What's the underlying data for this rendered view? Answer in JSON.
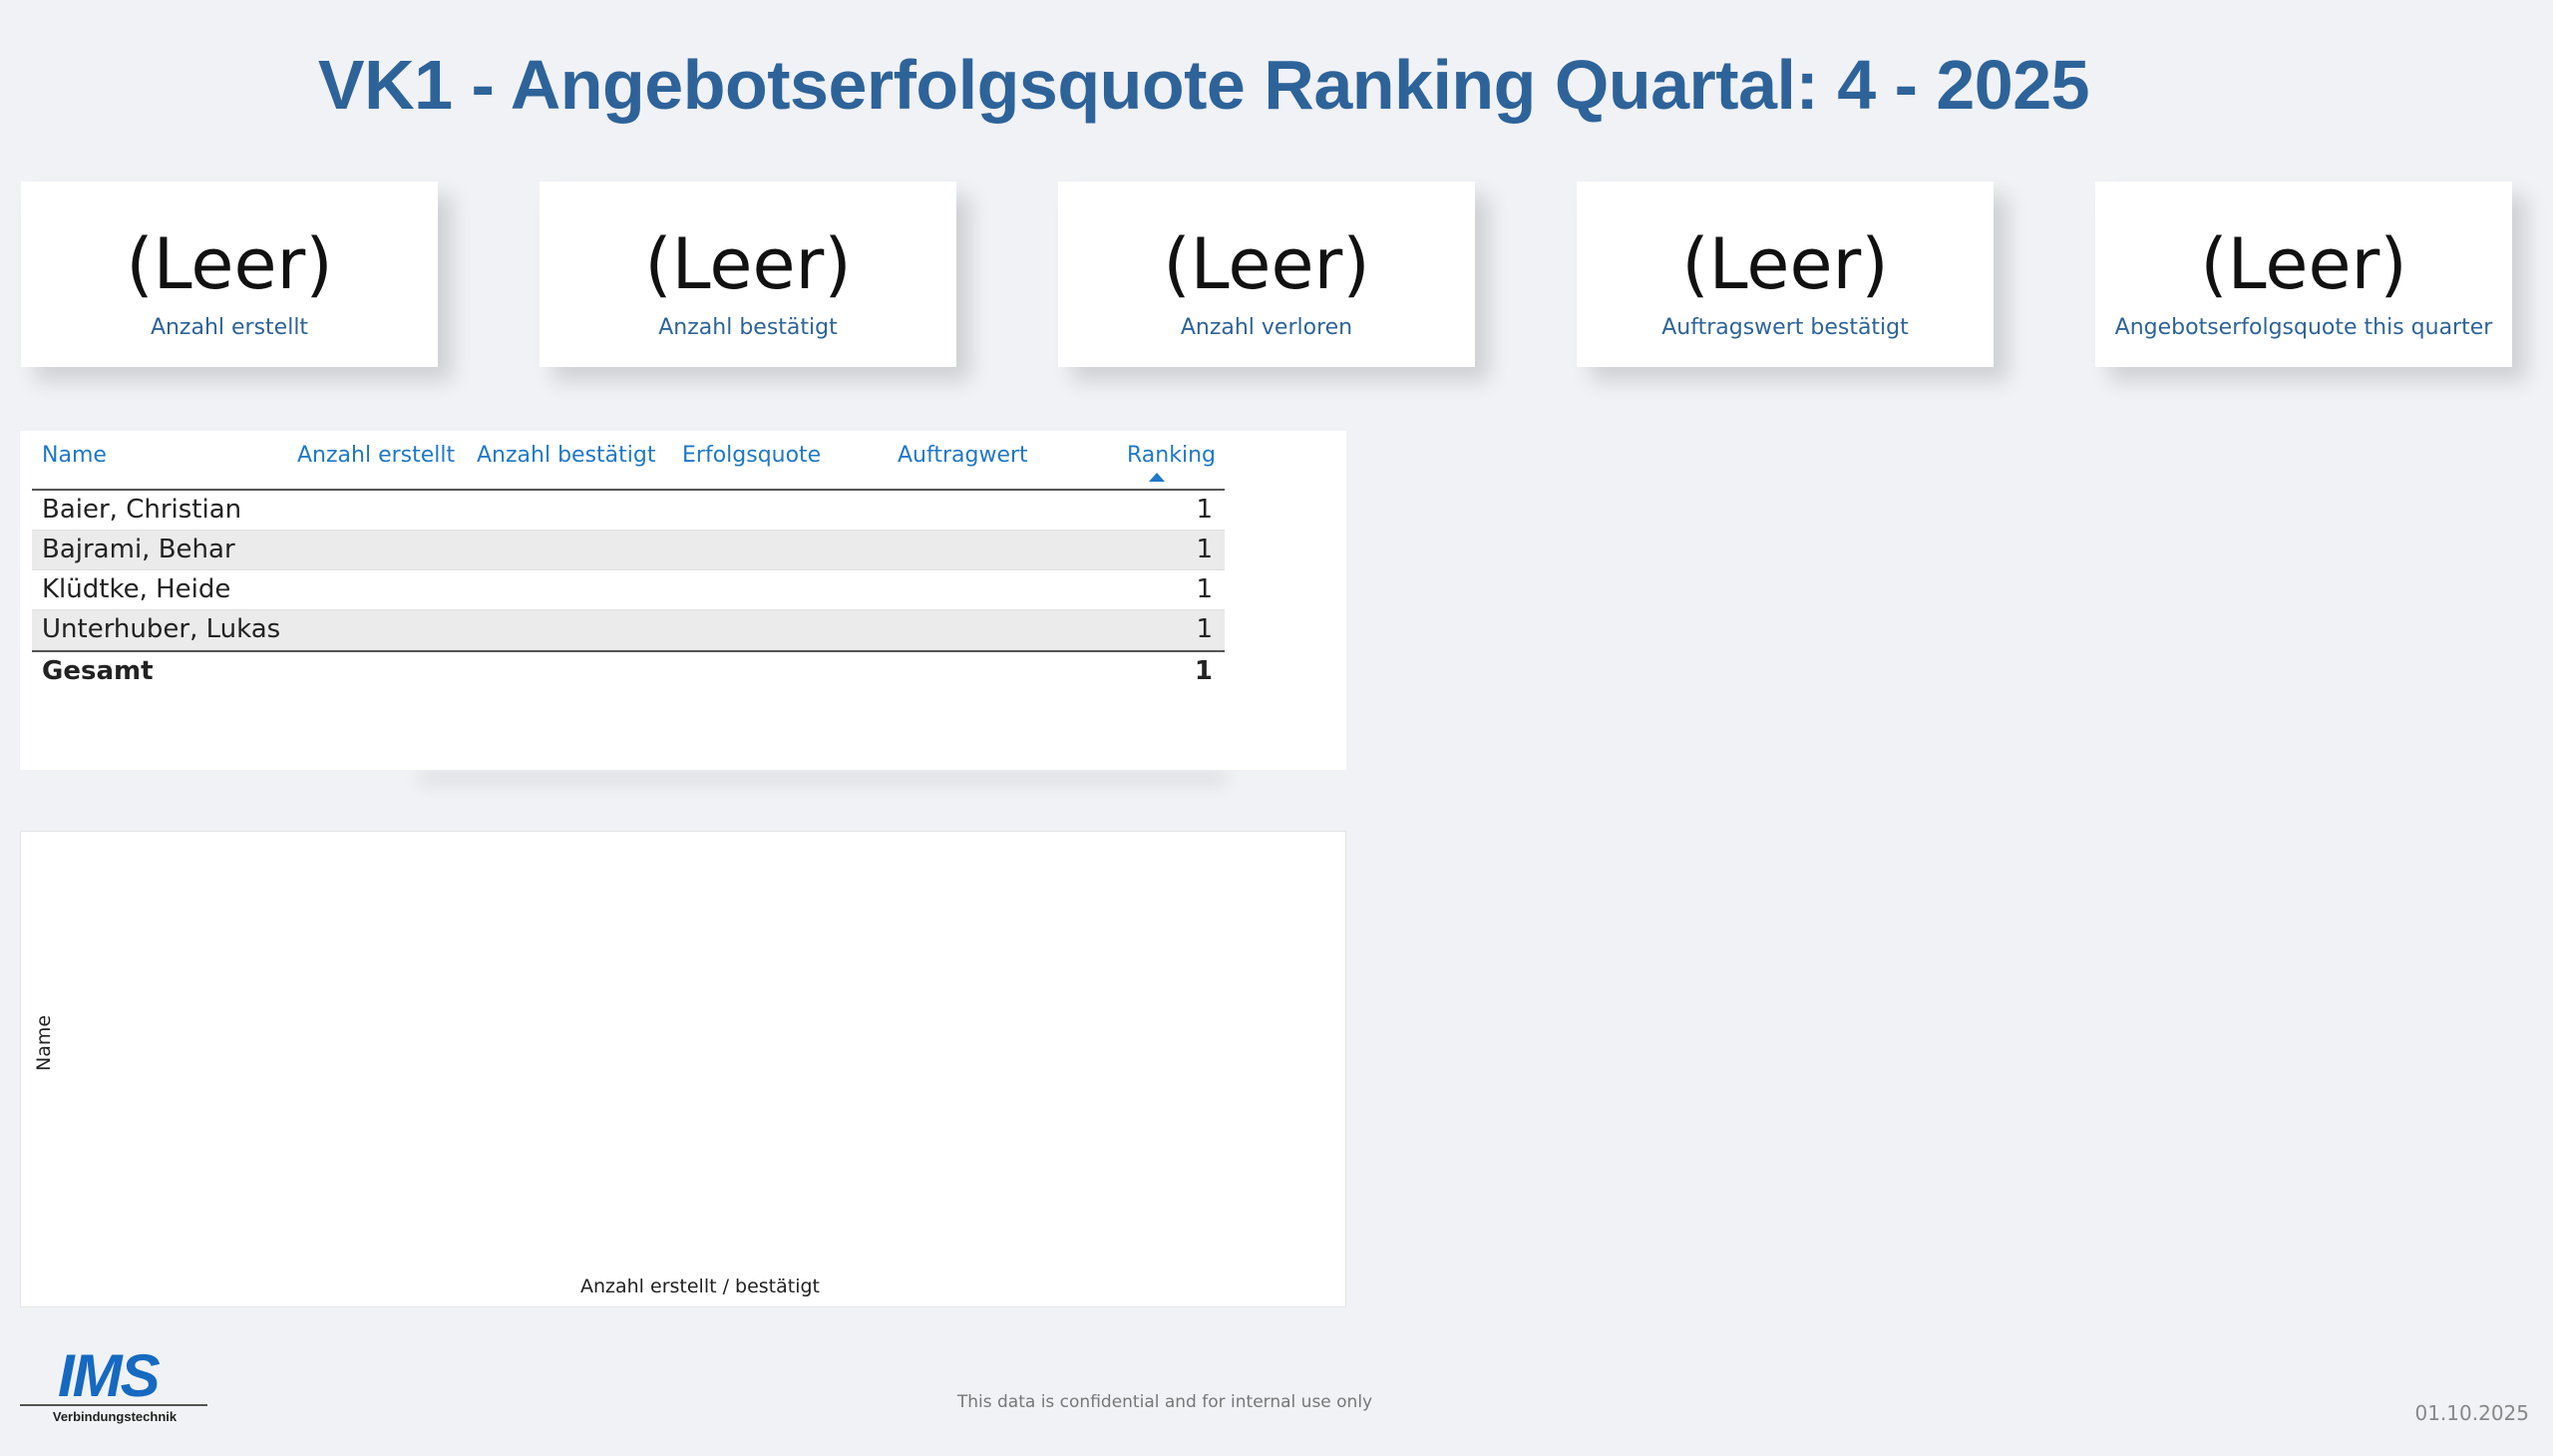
{
  "title": "VK1 - Angebotserfolgsquote Ranking Quartal: 4 - 2025",
  "cards": [
    {
      "value": "(Leer)",
      "label": "Anzahl erstellt"
    },
    {
      "value": "(Leer)",
      "label": "Anzahl bestätigt"
    },
    {
      "value": "(Leer)",
      "label": "Anzahl verloren"
    },
    {
      "value": "(Leer)",
      "label": "Auftragswert bestätigt"
    },
    {
      "value": "(Leer)",
      "label": "Angebotserfolgsquote this quarter"
    }
  ],
  "table": {
    "headers": [
      "Name",
      "Anzahl erstellt",
      "Anzahl bestätigt",
      "Erfolgsquote",
      "Auftragwert",
      "Ranking"
    ],
    "rows": [
      {
        "name": "Baier, Christian",
        "ranking": "1"
      },
      {
        "name": "Bajrami, Behar",
        "ranking": "1"
      },
      {
        "name": "Klüdtke, Heide",
        "ranking": "1"
      },
      {
        "name": "Unterhuber, Lukas",
        "ranking": "1"
      }
    ],
    "total": {
      "name": "Gesamt",
      "ranking": "1"
    }
  },
  "chart": {
    "ylabel": "Name",
    "xlabel": "Anzahl erstellt / bestätigt"
  },
  "logo": {
    "text": "IMS",
    "sub": "Verbindungstechnik"
  },
  "footer": {
    "confidential": "This data is confidential and for internal use only",
    "date": "01.10.2025"
  }
}
